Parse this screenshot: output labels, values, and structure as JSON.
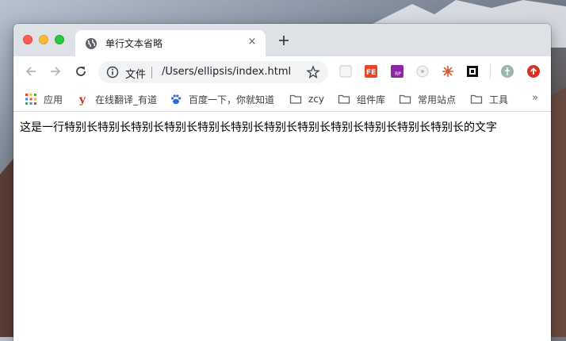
{
  "tab": {
    "title": "单行文本省略",
    "close": "×"
  },
  "omnibox": {
    "label": "文件",
    "url": "/Users/ellipsis/index.html"
  },
  "bookmarks": [
    {
      "label": "应用",
      "icon": "apps-grid-icon"
    },
    {
      "label": "在线翻译_有道",
      "icon": "youdao-icon"
    },
    {
      "label": "百度一下，你就知道",
      "icon": "baidu-paw-icon"
    },
    {
      "label": "zcy",
      "icon": "folder-icon"
    },
    {
      "label": "组件库",
      "icon": "folder-icon"
    },
    {
      "label": "常用站点",
      "icon": "folder-icon"
    },
    {
      "label": "工具",
      "icon": "folder-icon"
    }
  ],
  "bookmarks_more": "»",
  "extensions": [
    "ext-blank-icon",
    "fe-helper-icon",
    "rp-icon",
    "wappalyzer-icon",
    "bug-icon",
    "qr-icon",
    "profile-avatar-icon",
    "update-icon"
  ],
  "page": {
    "text": "这是一行特别长特别长特别长特别长特别长特别长特别长特别长特别长特别长特别长特别长的文字"
  },
  "colors": {
    "tabstrip": "#dee1e6",
    "accent_red": "#d93025"
  }
}
